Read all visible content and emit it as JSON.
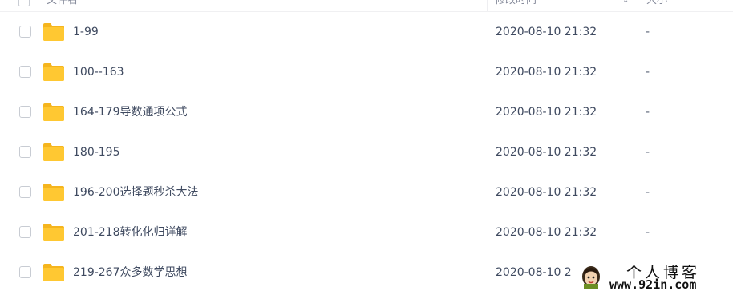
{
  "header": {
    "name_label": "文件名",
    "time_label": "修改时间",
    "size_label": "大小"
  },
  "files": [
    {
      "name": "1-99",
      "modified": "2020-08-10 21:32",
      "size": "-"
    },
    {
      "name": "100--163",
      "modified": "2020-08-10 21:32",
      "size": "-"
    },
    {
      "name": "164-179导数通项公式",
      "modified": "2020-08-10 21:32",
      "size": "-"
    },
    {
      "name": "180-195",
      "modified": "2020-08-10 21:32",
      "size": "-"
    },
    {
      "name": "196-200选择题秒杀大法",
      "modified": "2020-08-10 21:32",
      "size": "-"
    },
    {
      "name": "201-218转化化归详解",
      "modified": "2020-08-10 21:32",
      "size": "-"
    },
    {
      "name": "219-267众多数学思想",
      "modified": "2020-08-10 2",
      "size": "-"
    }
  ],
  "watermark": {
    "title": "个人博客",
    "url": "www.92in.com"
  },
  "colors": {
    "folder": "#ffc832",
    "folder_tab": "#f5b51e",
    "text": "#3f4a60"
  },
  "icons": {
    "folder": "folder-icon",
    "checkbox": "checkbox-icon",
    "sort": "sort-arrow-icon"
  }
}
